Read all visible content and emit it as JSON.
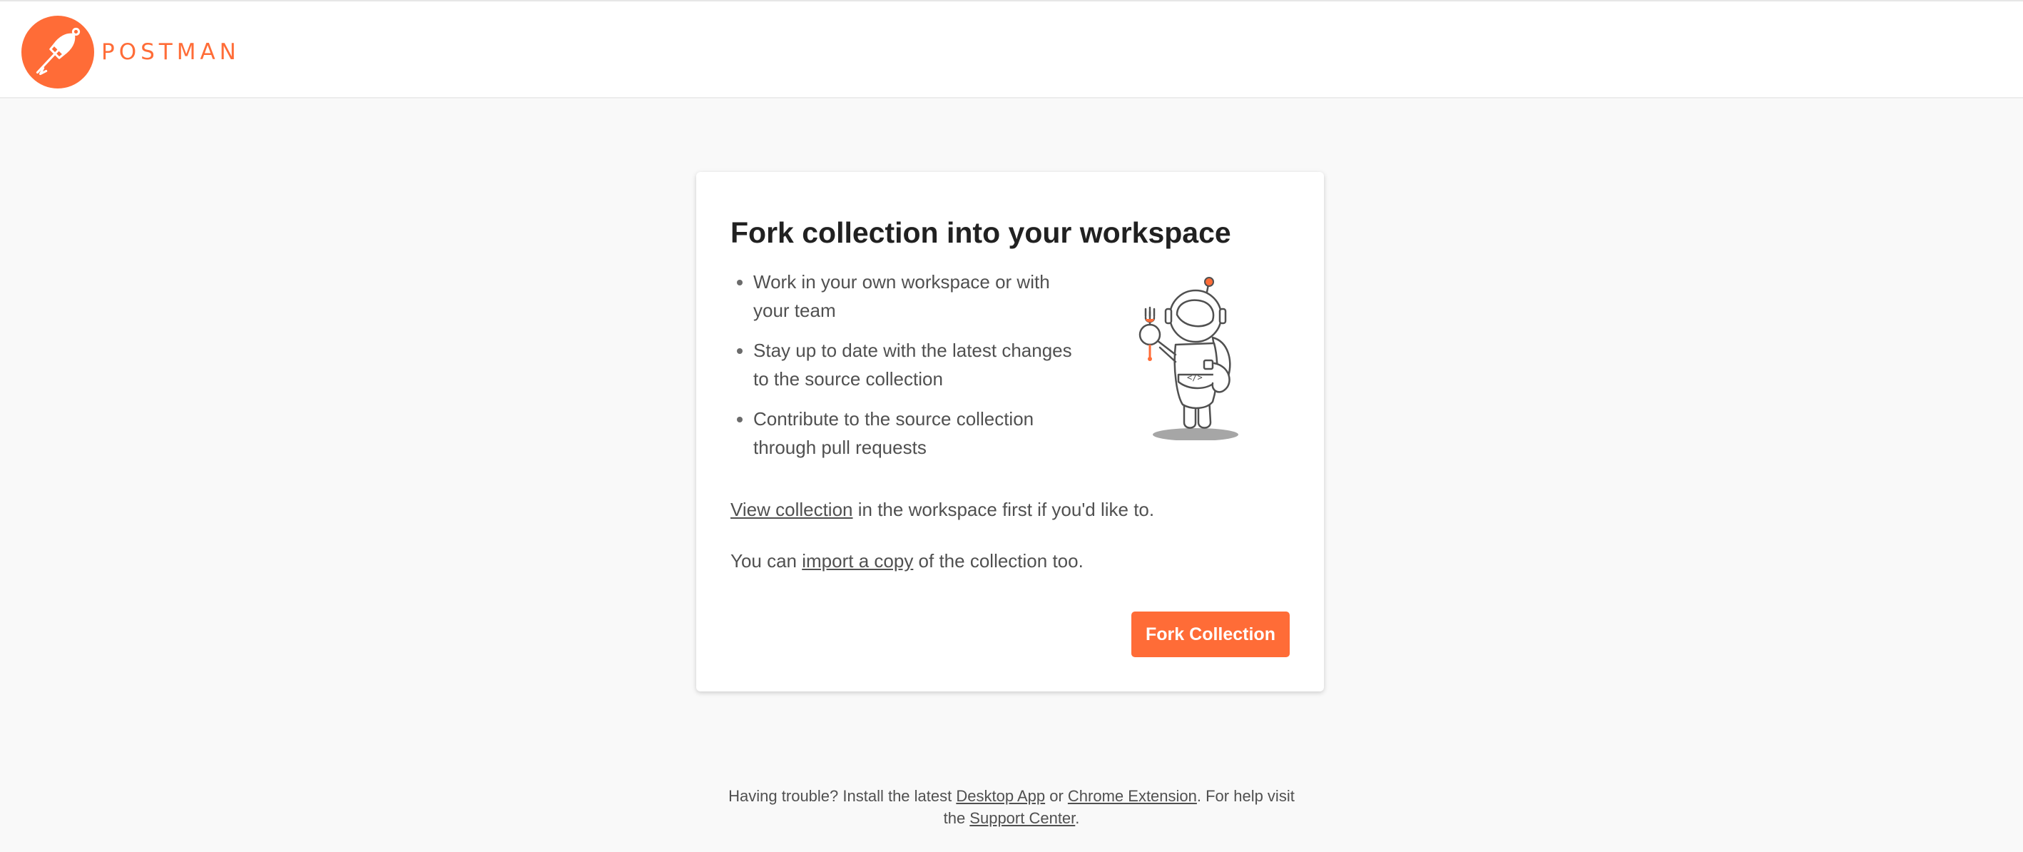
{
  "brand": {
    "name": "POSTMAN",
    "accent_color": "#ff6c37",
    "logo_icon": "postman-rocket-logo-icon"
  },
  "card": {
    "title": "Fork collection into your workspace",
    "benefits": [
      "Work in your own workspace or with your team",
      "Stay up to date with the latest changes to the source collection",
      "Contribute to the source collection through pull requests"
    ],
    "illustration_icon": "astronaut-fork-illustration",
    "view_note": {
      "link": "View collection",
      "rest": " in the workspace first if you'd like to."
    },
    "import_note": {
      "before": "You can ",
      "link": "import a copy",
      "after": " of the collection too."
    },
    "fork_button_label": "Fork Collection"
  },
  "footer": {
    "part1": "Having trouble? Install the latest ",
    "desktop_link": "Desktop App",
    "part2": " or ",
    "chrome_link": "Chrome Extension",
    "part3": ". For help visit the ",
    "support_link": "Support Center",
    "part4": "."
  }
}
